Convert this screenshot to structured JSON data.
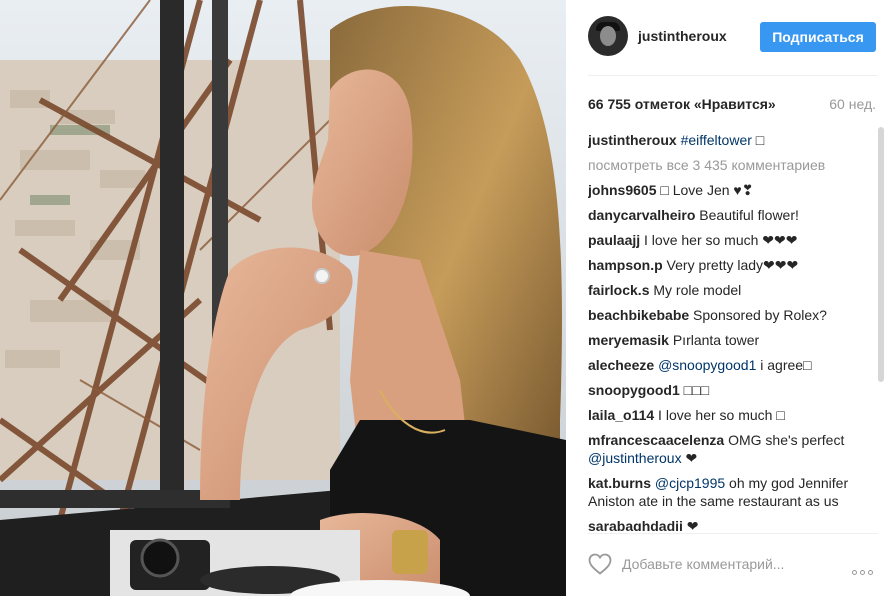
{
  "post": {
    "username": "justintheroux",
    "follow_label": "Подписаться",
    "likes_text": "66 755 отметок «Нравится»",
    "time_ago": "60 нед.",
    "view_all_comments": "посмотреть все 3 435 комментариев",
    "caption": {
      "user": "justintheroux",
      "hashtag": "#eiffeltower",
      "tail": " □"
    },
    "add_comment_placeholder": "Добавьте комментарий..."
  },
  "comments": [
    {
      "user": "johns9605",
      "pre": "",
      "mention": "",
      "text": " □ Love Jen ♥❣"
    },
    {
      "user": "danycarvalheiro",
      "pre": "",
      "mention": "",
      "text": " Beautiful flower!"
    },
    {
      "user": "paulaajj",
      "pre": "",
      "mention": "",
      "text": " I love her so much ❤❤❤"
    },
    {
      "user": "hampson.p",
      "pre": "",
      "mention": "",
      "text": " Very pretty lady❤❤❤"
    },
    {
      "user": "fairlock.s",
      "pre": "",
      "mention": "",
      "text": " My role model"
    },
    {
      "user": "beachbikebabe",
      "pre": "",
      "mention": "",
      "text": " Sponsored by Rolex?"
    },
    {
      "user": "meryemasik",
      "pre": "",
      "mention": "",
      "text": " Pırlanta tower"
    },
    {
      "user": "alecheeze",
      "pre": " ",
      "mention": "@snoopygood1",
      "text": " i agree□"
    },
    {
      "user": "snoopygood1",
      "pre": "",
      "mention": "",
      "text": " □□□"
    },
    {
      "user": "laila_o114",
      "pre": "",
      "mention": "",
      "text": " I love her so much □"
    },
    {
      "user": "mfrancescaacelenza",
      "pre": " OMG she's perfect ",
      "mention": "@justintheroux",
      "text": " ❤"
    },
    {
      "user": "kat.burns",
      "pre": " ",
      "mention": "@cjcp1995",
      "text": " oh my god Jennifer Aniston ate in the same restaurant as us"
    },
    {
      "user": "sarabaghdadii",
      "pre": "",
      "mention": "",
      "text": " ❤"
    }
  ],
  "icons": {
    "like": "heart-outline-icon",
    "more": "more-options-icon",
    "avatar": "profile-avatar"
  },
  "colors": {
    "accent": "#3897f0",
    "text": "#262626",
    "muted": "#999999",
    "link": "#003569"
  }
}
